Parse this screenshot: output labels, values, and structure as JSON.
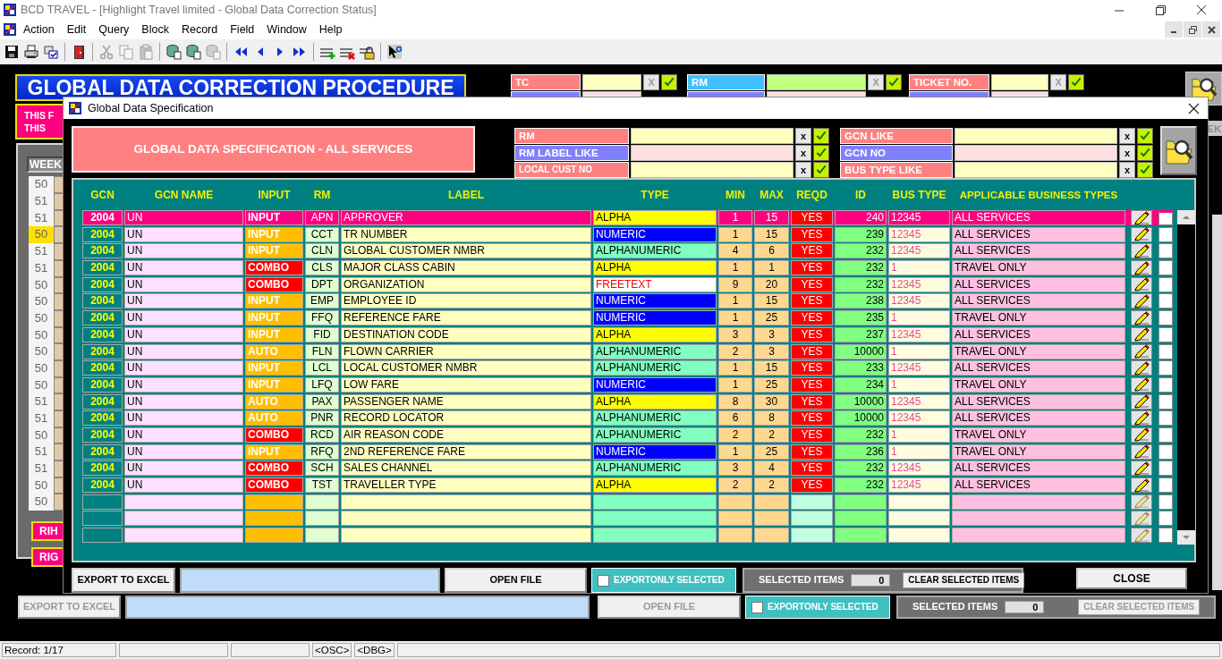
{
  "window": {
    "title": "BCD TRAVEL - [Highlight Travel limited - Global Data Correction Status]"
  },
  "menu": [
    "Action",
    "Edit",
    "Query",
    "Block",
    "Record",
    "Field",
    "Window",
    "Help"
  ],
  "toolbar": [
    {
      "buttons": [
        {
          "kind": "save",
          "disabled": false
        },
        {
          "kind": "print",
          "disabled": false
        },
        {
          "kind": "checklist",
          "disabled": false
        }
      ]
    },
    {
      "buttons": [
        {
          "kind": "exit",
          "disabled": false
        }
      ]
    },
    {
      "buttons": [
        {
          "kind": "cut",
          "disabled": true
        },
        {
          "kind": "copy",
          "disabled": true
        },
        {
          "kind": "paste",
          "disabled": true
        }
      ]
    },
    {
      "buttons": [
        {
          "kind": "query",
          "disabled": false
        },
        {
          "kind": "query",
          "disabled": false
        },
        {
          "kind": "query",
          "disabled": true
        }
      ]
    },
    {
      "buttons": [
        {
          "kind": "first",
          "disabled": false
        },
        {
          "kind": "prev",
          "disabled": false
        },
        {
          "kind": "next",
          "disabled": false
        },
        {
          "kind": "last",
          "disabled": false
        }
      ]
    },
    {
      "buttons": [
        {
          "kind": "insert",
          "disabled": false
        },
        {
          "kind": "delete",
          "disabled": false
        },
        {
          "kind": "lock",
          "disabled": false
        }
      ]
    },
    {
      "buttons": [
        {
          "kind": "help",
          "disabled": false
        }
      ]
    }
  ],
  "background_form": {
    "banner": "GLOBAL DATA CORRECTION PROCEDURE",
    "notice_lines": [
      "THIS F",
      "THIS"
    ],
    "filters": [
      {
        "label": "TC",
        "color": "#ff8080",
        "clear": "X",
        "clear_disabled": true
      },
      {
        "label": "RM",
        "color": "#40c0ff",
        "clear": "X",
        "clear_disabled": true
      },
      {
        "label": "TICKET NO.",
        "color": "#ff8080",
        "clear": "X",
        "clear_disabled": true
      }
    ],
    "side_button": "EK",
    "week_header": "WEEK",
    "weeks": [
      {
        "week": "50",
        "selected": false
      },
      {
        "week": "51",
        "selected": false
      },
      {
        "week": "51",
        "selected": false
      },
      {
        "week": "50",
        "selected": true
      },
      {
        "week": "51",
        "selected": false
      },
      {
        "week": "51",
        "selected": false
      },
      {
        "week": "50",
        "selected": false
      },
      {
        "week": "50",
        "selected": false
      },
      {
        "week": "50",
        "selected": false
      },
      {
        "week": "50",
        "selected": false
      },
      {
        "week": "50",
        "selected": false
      },
      {
        "week": "50",
        "selected": false
      },
      {
        "week": "50",
        "selected": false
      },
      {
        "week": "51",
        "selected": false
      },
      {
        "week": "51",
        "selected": false
      },
      {
        "week": "50",
        "selected": false
      },
      {
        "week": "51",
        "selected": false
      },
      {
        "week": "51",
        "selected": false
      },
      {
        "week": "50",
        "selected": false
      },
      {
        "week": "50",
        "selected": false
      }
    ],
    "buttons": [
      "RIH",
      "RIG"
    ],
    "export_button": {
      "label": "EXPORT TO EXCEL",
      "disabled": true
    },
    "open_file_button": {
      "label": "OPEN FILE",
      "disabled": true
    },
    "export_only_selected": {
      "label": "EXPORTONLY SELECTED",
      "checked": false
    },
    "selected_items": {
      "label": "SELECTED ITEMS",
      "value": "0"
    },
    "clear_button": {
      "label": "CLEAR SELECTED ITEMS",
      "disabled": true
    }
  },
  "dialog": {
    "title": "Global Data Specification",
    "heading": "GLOBAL DATA SPECIFICATION - ALL SERVICES",
    "filter_groups": [
      {
        "filters": [
          {
            "label": "RM",
            "color": "#ff8080",
            "clear": "x",
            "clear_disabled": false
          },
          {
            "label": "RM LABEL LIKE",
            "color": "#8080ff",
            "clear": "x",
            "clear_disabled": false
          },
          {
            "label": "LOCAL CUST NO",
            "color": "#ff8080",
            "clear": "x",
            "clear_disabled": false
          }
        ]
      },
      {
        "filters": [
          {
            "label": "GCN LIKE",
            "color": "#ff8080",
            "clear": "x",
            "clear_disabled": false
          },
          {
            "label": "GCN NO",
            "color": "#8080ff",
            "clear": "x",
            "clear_disabled": false
          },
          {
            "label": "BUS TYPE LIKE",
            "color": "#ff8080",
            "clear": "x",
            "clear_disabled": false
          }
        ]
      }
    ],
    "columns": [
      "GCN",
      "GCN NAME",
      "INPUT",
      "RM",
      "LABEL",
      "TYPE",
      "MIN",
      "MAX",
      "REQD",
      "ID",
      "BUS TYPE",
      "APPLICABLE BUSINESS TYPES"
    ],
    "rows": [
      {
        "gcn": "2004",
        "name": "UN",
        "input": {
          "text": "INPUT",
          "color": "#ff0080"
        },
        "rm": "APN",
        "label": "APPROVER",
        "type": {
          "text": "ALPHA",
          "color": "#ffff00"
        },
        "min": "1",
        "max": "15",
        "reqd": "YES",
        "id": "240",
        "bus_type": "12345",
        "applicable": "ALL SERVICES",
        "checked": false,
        "selected": true
      },
      {
        "gcn": "2004",
        "name": "UN",
        "input": {
          "text": "INPUT",
          "color": "#ffbf00"
        },
        "rm": "CCT",
        "label": "TR NUMBER",
        "type": {
          "text": "NUMERIC",
          "color": "#0000ff"
        },
        "min": "1",
        "max": "15",
        "reqd": "YES",
        "id": "239",
        "bus_type": "12345",
        "applicable": "ALL SERVICES",
        "checked": false,
        "selected": false
      },
      {
        "gcn": "2004",
        "name": "UN",
        "input": {
          "text": "INPUT",
          "color": "#ffbf00"
        },
        "rm": "CLN",
        "label": "GLOBAL CUSTOMER NMBR",
        "type": {
          "text": "ALPHANUMERIC",
          "color": "#80ffc0"
        },
        "min": "4",
        "max": "6",
        "reqd": "YES",
        "id": "232",
        "bus_type": "12345",
        "applicable": "ALL SERVICES",
        "checked": false,
        "selected": false
      },
      {
        "gcn": "2004",
        "name": "UN",
        "input": {
          "text": "COMBO",
          "color": "#ff0000"
        },
        "rm": "CLS",
        "label": "MAJOR CLASS CABIN",
        "type": {
          "text": "ALPHA",
          "color": "#ffff00"
        },
        "min": "1",
        "max": "1",
        "reqd": "YES",
        "id": "232",
        "bus_type": "1",
        "applicable": "TRAVEL ONLY",
        "checked": false,
        "selected": false
      },
      {
        "gcn": "2004",
        "name": "UN",
        "input": {
          "text": "COMBO",
          "color": "#ff0000"
        },
        "rm": "DPT",
        "label": "ORGANIZATION",
        "type": {
          "text": "FREETEXT",
          "color": "#ffffff"
        },
        "min": "9",
        "max": "20",
        "reqd": "YES",
        "id": "232",
        "bus_type": "12345",
        "applicable": "ALL SERVICES",
        "checked": false,
        "selected": false
      },
      {
        "gcn": "2004",
        "name": "UN",
        "input": {
          "text": "INPUT",
          "color": "#ffbf00"
        },
        "rm": "EMP",
        "label": "EMPLOYEE ID",
        "type": {
          "text": "NUMERIC",
          "color": "#0000ff"
        },
        "min": "1",
        "max": "15",
        "reqd": "YES",
        "id": "238",
        "bus_type": "12345",
        "applicable": "ALL SERVICES",
        "checked": false,
        "selected": false
      },
      {
        "gcn": "2004",
        "name": "UN",
        "input": {
          "text": "INPUT",
          "color": "#ffbf00"
        },
        "rm": "FFQ",
        "label": "REFERENCE FARE",
        "type": {
          "text": "NUMERIC",
          "color": "#0000ff"
        },
        "min": "1",
        "max": "25",
        "reqd": "YES",
        "id": "235",
        "bus_type": "1",
        "applicable": "TRAVEL ONLY",
        "checked": false,
        "selected": false
      },
      {
        "gcn": "2004",
        "name": "UN",
        "input": {
          "text": "INPUT",
          "color": "#ffbf00"
        },
        "rm": "FID",
        "label": "DESTINATION CODE",
        "type": {
          "text": "ALPHA",
          "color": "#ffff00"
        },
        "min": "3",
        "max": "3",
        "reqd": "YES",
        "id": "237",
        "bus_type": "12345",
        "applicable": "ALL SERVICES",
        "checked": false,
        "selected": false
      },
      {
        "gcn": "2004",
        "name": "UN",
        "input": {
          "text": "AUTO",
          "color": "#ffbf00"
        },
        "rm": "FLN",
        "label": "FLOWN CARRIER",
        "type": {
          "text": "ALPHANUMERIC",
          "color": "#80ffc0"
        },
        "min": "2",
        "max": "3",
        "reqd": "YES",
        "id": "10000",
        "bus_type": "1",
        "applicable": "TRAVEL ONLY",
        "checked": false,
        "selected": false
      },
      {
        "gcn": "2004",
        "name": "UN",
        "input": {
          "text": "INPUT",
          "color": "#ffbf00"
        },
        "rm": "LCL",
        "label": "LOCAL CUSTOMER NMBR",
        "type": {
          "text": "ALPHANUMERIC",
          "color": "#80ffc0"
        },
        "min": "1",
        "max": "15",
        "reqd": "YES",
        "id": "233",
        "bus_type": "12345",
        "applicable": "ALL SERVICES",
        "checked": false,
        "selected": false
      },
      {
        "gcn": "2004",
        "name": "UN",
        "input": {
          "text": "INPUT",
          "color": "#ffbf00"
        },
        "rm": "LFQ",
        "label": "LOW FARE",
        "type": {
          "text": "NUMERIC",
          "color": "#0000ff"
        },
        "min": "1",
        "max": "25",
        "reqd": "YES",
        "id": "234",
        "bus_type": "1",
        "applicable": "TRAVEL ONLY",
        "checked": false,
        "selected": false
      },
      {
        "gcn": "2004",
        "name": "UN",
        "input": {
          "text": "AUTO",
          "color": "#ffbf00"
        },
        "rm": "PAX",
        "label": "PASSENGER NAME",
        "type": {
          "text": "ALPHA",
          "color": "#ffff00"
        },
        "min": "8",
        "max": "30",
        "reqd": "YES",
        "id": "10000",
        "bus_type": "12345",
        "applicable": "ALL SERVICES",
        "checked": false,
        "selected": false
      },
      {
        "gcn": "2004",
        "name": "UN",
        "input": {
          "text": "AUTO",
          "color": "#ffbf00"
        },
        "rm": "PNR",
        "label": "RECORD LOCATOR",
        "type": {
          "text": "ALPHANUMERIC",
          "color": "#80ffc0"
        },
        "min": "6",
        "max": "8",
        "reqd": "YES",
        "id": "10000",
        "bus_type": "12345",
        "applicable": "ALL SERVICES",
        "checked": false,
        "selected": false
      },
      {
        "gcn": "2004",
        "name": "UN",
        "input": {
          "text": "COMBO",
          "color": "#ff0000"
        },
        "rm": "RCD",
        "label": "AIR REASON CODE",
        "type": {
          "text": "ALPHANUMERIC",
          "color": "#80ffc0"
        },
        "min": "2",
        "max": "2",
        "reqd": "YES",
        "id": "232",
        "bus_type": "1",
        "applicable": "TRAVEL ONLY",
        "checked": false,
        "selected": false
      },
      {
        "gcn": "2004",
        "name": "UN",
        "input": {
          "text": "INPUT",
          "color": "#ffbf00"
        },
        "rm": "RFQ",
        "label": "2ND REFERENCE FARE",
        "type": {
          "text": "NUMERIC",
          "color": "#0000ff"
        },
        "min": "1",
        "max": "25",
        "reqd": "YES",
        "id": "236",
        "bus_type": "1",
        "applicable": "TRAVEL ONLY",
        "checked": false,
        "selected": false
      },
      {
        "gcn": "2004",
        "name": "UN",
        "input": {
          "text": "COMBO",
          "color": "#ff0000"
        },
        "rm": "SCH",
        "label": "SALES CHANNEL",
        "type": {
          "text": "ALPHANUMERIC",
          "color": "#80ffc0"
        },
        "min": "3",
        "max": "4",
        "reqd": "YES",
        "id": "232",
        "bus_type": "12345",
        "applicable": "ALL SERVICES",
        "checked": false,
        "selected": false
      },
      {
        "gcn": "2004",
        "name": "UN",
        "input": {
          "text": "COMBO",
          "color": "#ff0000"
        },
        "rm": "TST",
        "label": "TRAVELLER TYPE",
        "type": {
          "text": "ALPHA",
          "color": "#ffff00"
        },
        "min": "2",
        "max": "2",
        "reqd": "YES",
        "id": "232",
        "bus_type": "12345",
        "applicable": "ALL SERVICES",
        "checked": false,
        "selected": false
      }
    ],
    "blank_rows": [
      {
        "checked": false
      },
      {
        "checked": false
      },
      {
        "checked": false
      }
    ],
    "export_button": {
      "label": "EXPORT TO EXCEL",
      "disabled": false
    },
    "open_file_button": {
      "label": "OPEN FILE",
      "disabled": false
    },
    "export_only_selected": {
      "label": "EXPORTONLY SELECTED",
      "checked": false
    },
    "selected_items": {
      "label": "SELECTED ITEMS",
      "value": "0"
    },
    "clear_button": {
      "label": "CLEAR SELECTED ITEMS",
      "disabled": false
    },
    "close_button": "CLOSE"
  },
  "status_bar": {
    "record": "Record: 1/17",
    "indicators": [
      "<OSC>",
      "<DBG>"
    ]
  }
}
